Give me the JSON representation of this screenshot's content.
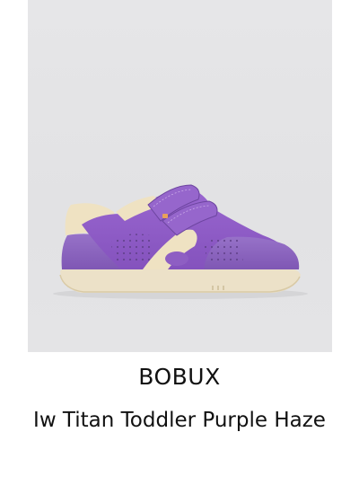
{
  "product": {
    "brand": "BOBUX",
    "name": "Iw Titan Toddler Purple Haze",
    "image_subject": "shoe-image"
  },
  "colors": {
    "image_background": "#e4e4e6",
    "upper_purple": "#8f5fc4",
    "suede_purple": "#8a63be",
    "cream": "#efe2c2",
    "sole": "#ece1c8",
    "text": "#111111"
  }
}
